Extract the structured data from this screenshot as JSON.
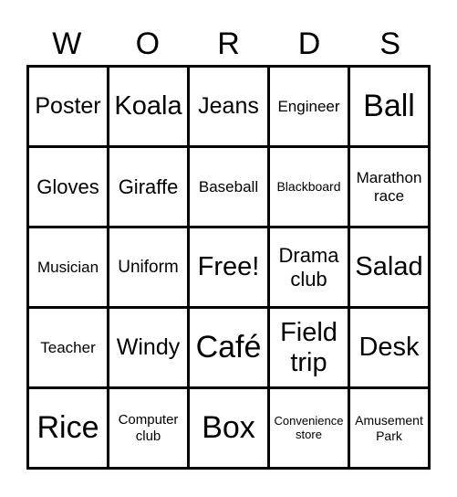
{
  "header": {
    "letters": [
      "W",
      "O",
      "R",
      "D",
      "S"
    ]
  },
  "cells": [
    [
      "Poster",
      "Koala",
      "Jeans",
      "Engineer",
      "Ball"
    ],
    [
      "Gloves",
      "Giraffe",
      "Baseball",
      "Blackboard",
      "Marathon race"
    ],
    [
      "Musician",
      "Uniform",
      "Free!",
      "Drama club",
      "Salad"
    ],
    [
      "Teacher",
      "Windy",
      "Café",
      "Field trip",
      "Desk"
    ],
    [
      "Rice",
      "Computer club",
      "Box",
      "Convenience store",
      "Amusement Park"
    ]
  ]
}
